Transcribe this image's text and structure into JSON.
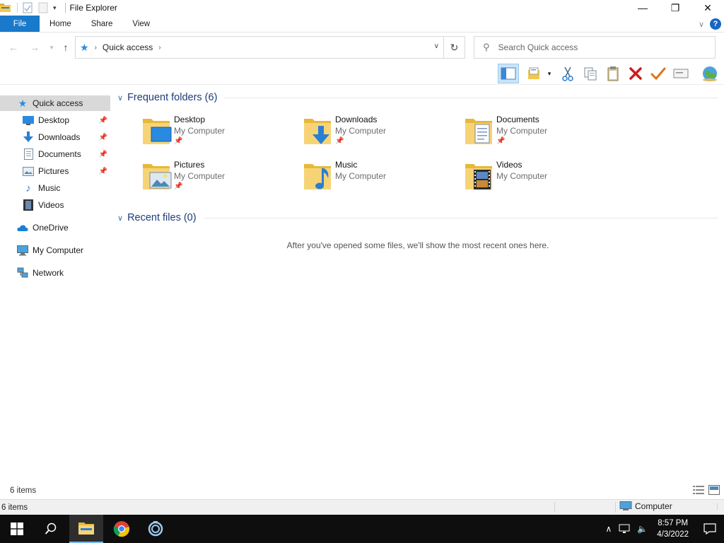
{
  "window": {
    "title": "File Explorer",
    "minimize": "—",
    "maximize": "❐",
    "close": "✕"
  },
  "ribbon": {
    "tabs": [
      "File",
      "Home",
      "Share",
      "View"
    ],
    "help": "?",
    "collapse": "∨"
  },
  "address": {
    "location": "Quick access",
    "search_placeholder": "Search Quick access"
  },
  "sidebar": {
    "items": [
      {
        "label": "Quick access",
        "icon": "star-icon",
        "selected": true,
        "pinned": false
      },
      {
        "label": "Desktop",
        "icon": "desktop-icon",
        "pinned": true
      },
      {
        "label": "Downloads",
        "icon": "download-icon",
        "pinned": true
      },
      {
        "label": "Documents",
        "icon": "document-icon",
        "pinned": true
      },
      {
        "label": "Pictures",
        "icon": "picture-icon",
        "pinned": true
      },
      {
        "label": "Music",
        "icon": "music-icon",
        "pinned": false
      },
      {
        "label": "Videos",
        "icon": "video-icon",
        "pinned": false
      },
      {
        "label": "OneDrive",
        "icon": "cloud-icon",
        "pinned": false
      },
      {
        "label": "My Computer",
        "icon": "computer-icon",
        "pinned": false
      },
      {
        "label": "Network",
        "icon": "network-icon",
        "pinned": false
      }
    ]
  },
  "main": {
    "frequent_title": "Frequent folders (6)",
    "recent_title": "Recent files (0)",
    "empty_message": "After you've opened some files, we'll show the most recent ones here.",
    "folders": [
      {
        "name": "Desktop",
        "location": "My Computer",
        "pinned": true
      },
      {
        "name": "Downloads",
        "location": "My Computer",
        "pinned": true
      },
      {
        "name": "Documents",
        "location": "My Computer",
        "pinned": true
      },
      {
        "name": "Pictures",
        "location": "My Computer",
        "pinned": true
      },
      {
        "name": "Music",
        "location": "My Computer",
        "pinned": false
      },
      {
        "name": "Videos",
        "location": "My Computer",
        "pinned": false
      }
    ]
  },
  "status": {
    "items_count": "6 items",
    "items_count_bottom": "6 items",
    "zone": "Computer"
  },
  "taskbar": {
    "time": "8:57 PM",
    "date": "4/3/2022"
  },
  "colors": {
    "accent": "#1979ca",
    "group_title": "#1e3c78",
    "folder": "#f2c94c",
    "taskbar": "#0e0e0e"
  }
}
